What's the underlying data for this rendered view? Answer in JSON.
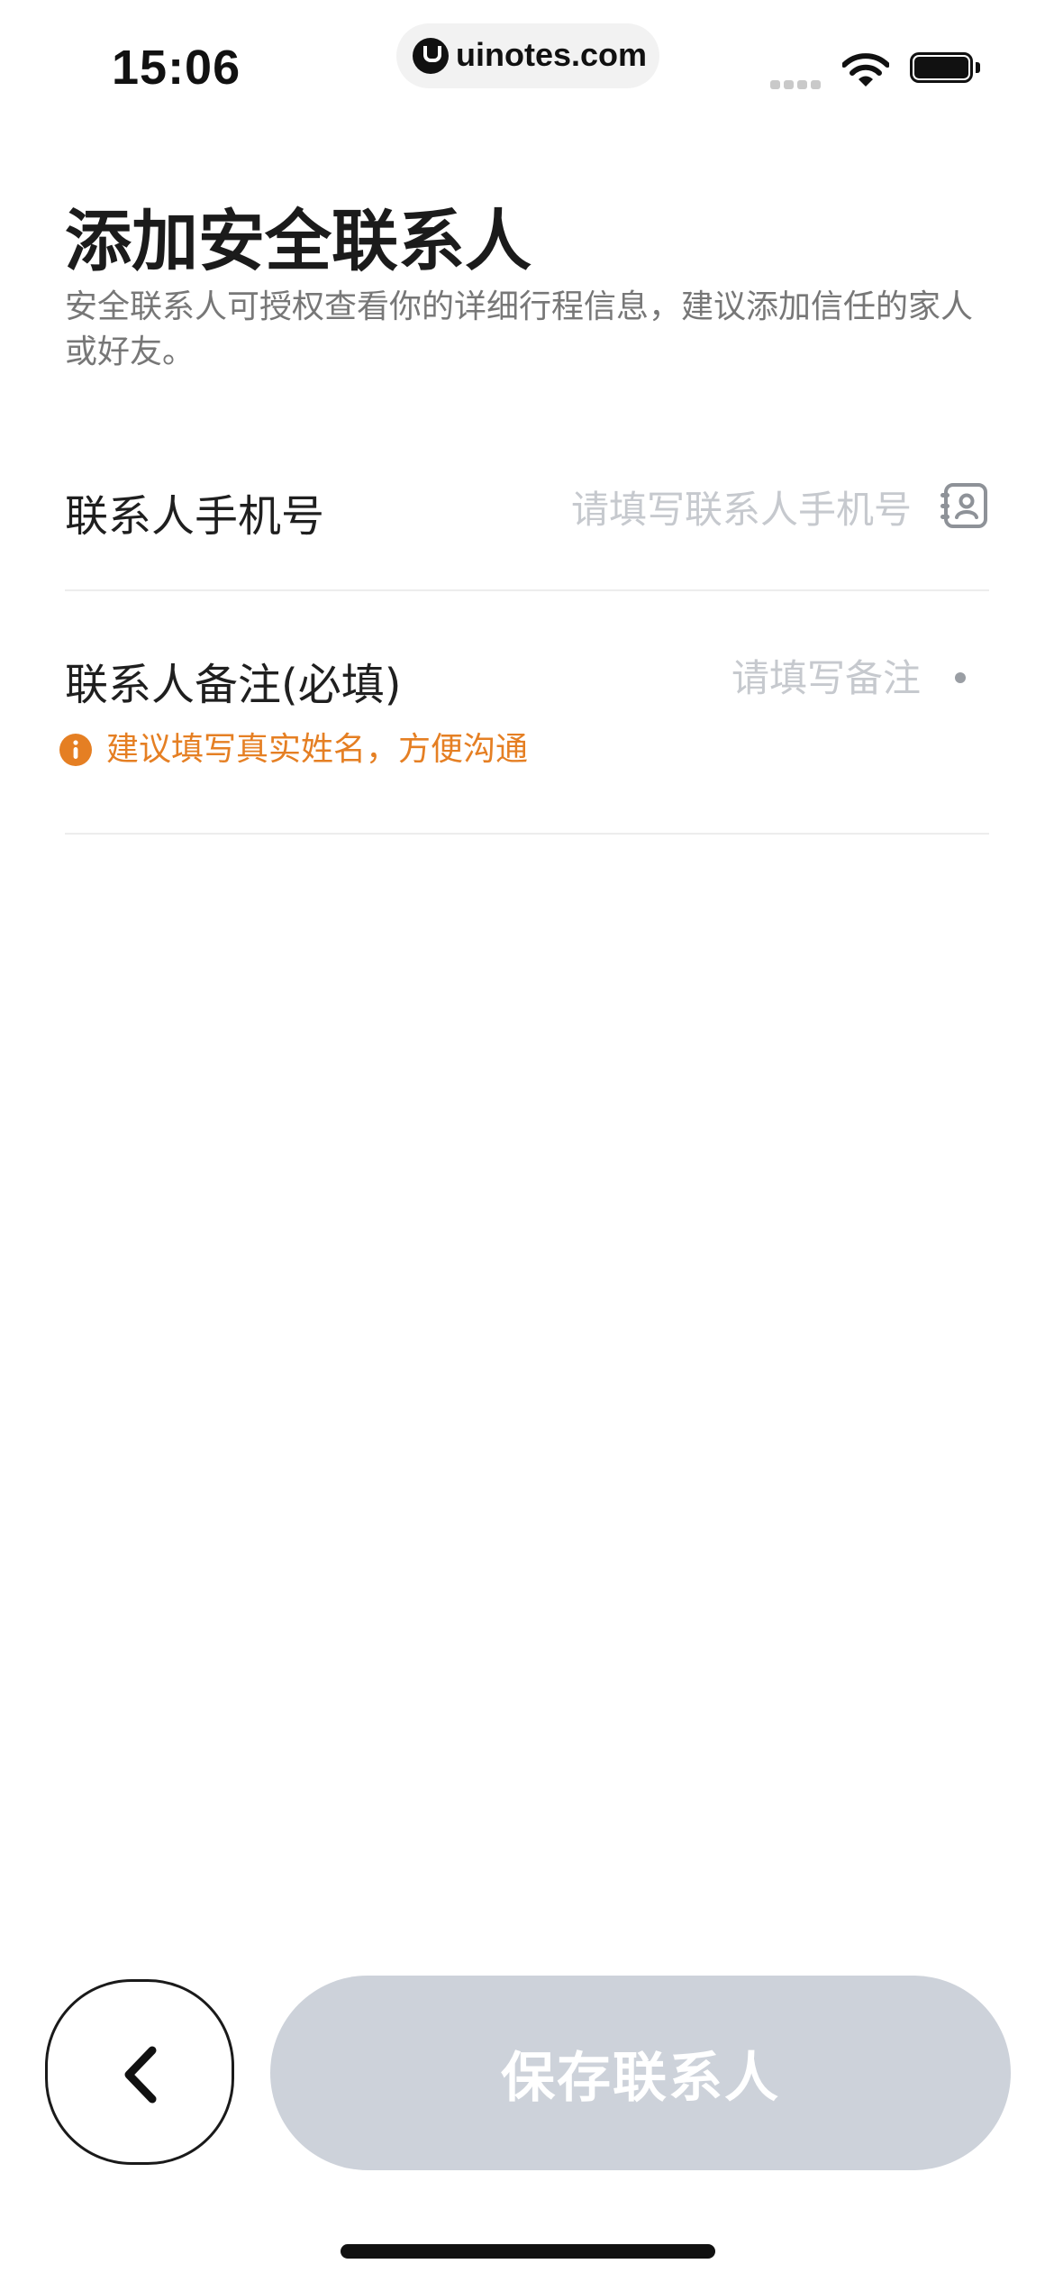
{
  "status_bar": {
    "time": "15:06",
    "url": "uinotes.com",
    "icons": [
      "signal-icon",
      "wifi-icon",
      "battery-icon"
    ]
  },
  "header": {
    "title": "添加安全联系人",
    "subtitle": "安全联系人可授权查看你的详细行程信息，建议添加信任的家人或好友。"
  },
  "form": {
    "phone": {
      "label": "联系人手机号",
      "placeholder": "请填写联系人手机号",
      "value": "",
      "icon": "contacts-icon"
    },
    "note": {
      "label": "联系人备注(必填)",
      "placeholder": "请填写备注",
      "value": "",
      "hint": "建议填写真实姓名，方便沟通",
      "hint_icon": "info-icon"
    }
  },
  "actions": {
    "back_icon": "chevron-left-icon",
    "save_label": "保存联系人"
  },
  "colors": {
    "hint": "#e57f23",
    "save_button_disabled": "#cdd2da",
    "placeholder": "#c6c9ce"
  }
}
